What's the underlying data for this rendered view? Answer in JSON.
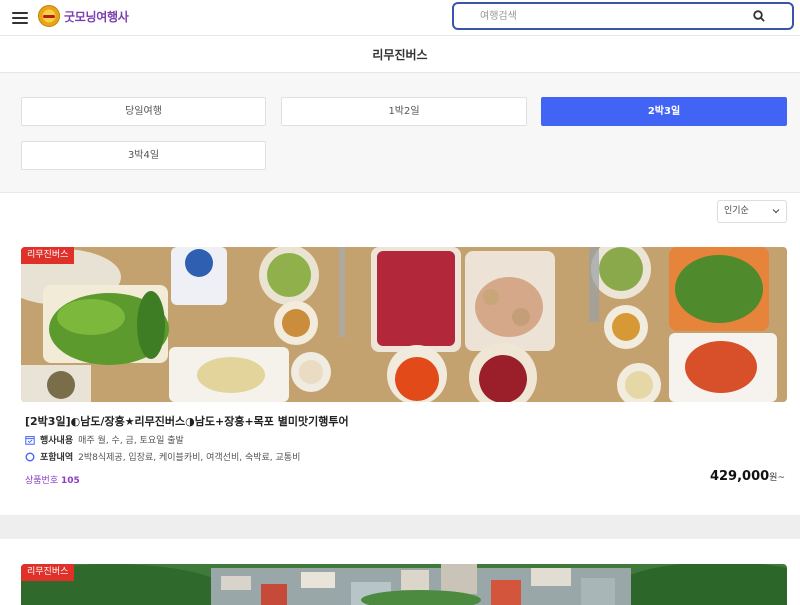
{
  "header": {
    "logo_text": "굿모닝여행사",
    "search_placeholder": "여행검색"
  },
  "page_title": "리무진버스",
  "filters": [
    {
      "label": "당일여행",
      "active": false
    },
    {
      "label": "1박2일",
      "active": false
    },
    {
      "label": "2박3일",
      "active": true
    },
    {
      "label": "3박4일",
      "active": false
    }
  ],
  "sort": {
    "selected": "인기순"
  },
  "products": [
    {
      "badge": "리무진버스",
      "title": "[2박3일]◐남도/장흥★리무진버스◑남도+장흥+목포 별미맛기행투어",
      "schedule_label": "행사내용",
      "schedule_value": "매주 월, 수, 금, 토요일 출발",
      "includes_label": "포함내역",
      "includes_value": "2박8식제공, 입장료, 케이블카비, 여객선비, 숙박료, 교통비",
      "product_no_label": "상품번호",
      "product_no": "105",
      "price": "429,000",
      "price_unit": "원~"
    },
    {
      "badge": "리무진버스"
    }
  ],
  "colors": {
    "accent": "#4264f5",
    "badge": "#e0302a",
    "search_border": "#3a54a8",
    "product_no": "#8a3fc6"
  }
}
